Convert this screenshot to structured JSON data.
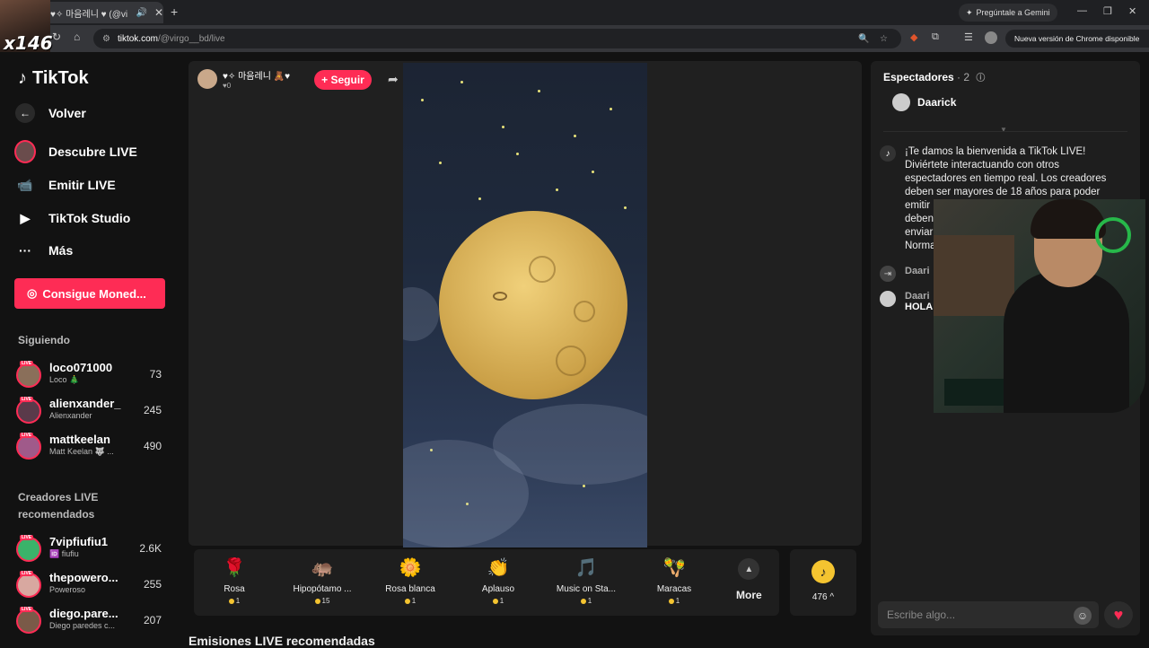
{
  "browser": {
    "tab_title": "♥✧ 마음레니 ♥ (@vi",
    "new_tab": "+",
    "gemini": "Pregúntale a Gemini",
    "url_host": "tiktok.com",
    "url_path": "/@virgo__bd/live",
    "update_label": "Nueva versión de Chrome disponible"
  },
  "overlay": {
    "multiplier": "x146"
  },
  "sidebar": {
    "brand": "TikTok",
    "back": "Volver",
    "nav": [
      {
        "label": "Descubre LIVE"
      },
      {
        "label": "Emitir LIVE"
      },
      {
        "label": "TikTok Studio"
      },
      {
        "label": "Más"
      }
    ],
    "coins_button": "Consigue Moned...",
    "following_title": "Siguiendo",
    "following": [
      {
        "name": "loco071000",
        "sub": "Loco 🎄",
        "count": "73"
      },
      {
        "name": "alienxander_",
        "sub": "Alienxander",
        "count": "245"
      },
      {
        "name": "mattkeelan",
        "sub": "Matt Keelan 🐺 ...",
        "count": "490"
      }
    ],
    "recommended_title": "Creadores LIVE recomendados",
    "recommended": [
      {
        "name": "7vipfiufiu1",
        "sub": "🆔 fiufiu",
        "count": "2.6K"
      },
      {
        "name": "thepowero...",
        "sub": "Poweroso",
        "count": "255"
      },
      {
        "name": "diego.pare...",
        "sub": "Diego paredes c...",
        "count": "207"
      }
    ],
    "live_tag": "LIVE"
  },
  "stream": {
    "host_name": "♥✧ 마음레니 🧸♥",
    "host_likes": "♥0",
    "follow_label": "+ Seguir"
  },
  "gifts": [
    {
      "name": "Rosa",
      "price": "1",
      "icon": "🌹"
    },
    {
      "name": "Hipopótamo ...",
      "price": "15",
      "icon": "🦛"
    },
    {
      "name": "Rosa blanca",
      "price": "1",
      "icon": "🌼"
    },
    {
      "name": "Aplauso",
      "price": "1",
      "icon": "👏"
    },
    {
      "name": "Music on Sta...",
      "price": "1",
      "icon": "🎵"
    },
    {
      "name": "Maracas",
      "price": "1",
      "icon": "🪇"
    }
  ],
  "more_label": "More",
  "wallet": {
    "balance": "476 ^"
  },
  "recommended_streams_title": "Emisiones LIVE recomendadas",
  "chat": {
    "viewers_title": "Espectadores",
    "viewers_count": "· 2",
    "viewer_name": "Daarick",
    "welcome_text": "¡Te damos la bienvenida a TikTok LIVE! Diviértete interactuando con otros espectadores en tiempo real. Los creadores deben ser mayores de 18 años para poder emitir un",
    "welcome_tail_1": "deben",
    "welcome_tail_2": "enviar",
    "welcome_tail_3": "Norma",
    "msg1_name": "Daari",
    "msg2_name": "Daari",
    "msg2_text": "HOLA",
    "input_placeholder": "Escribe algo..."
  }
}
